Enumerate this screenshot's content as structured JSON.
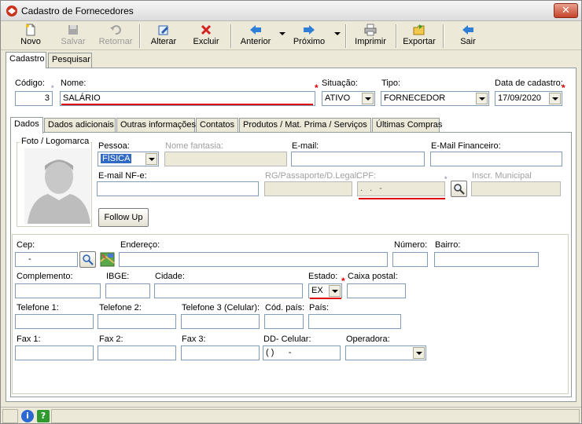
{
  "window": {
    "title": "Cadastro de Fornecedores"
  },
  "toolbar": {
    "novo": "Novo",
    "salvar": "Salvar",
    "retornar": "Retornar",
    "alterar": "Alterar",
    "excluir": "Excluir",
    "anterior": "Anterior",
    "proximo": "Próximo",
    "imprimir": "Imprimir",
    "exportar": "Exportar",
    "sair": "Sair"
  },
  "top_tabs": [
    "Cadastro",
    "Pesquisar"
  ],
  "header": {
    "codigo_label": "Código:",
    "codigo_value": "3",
    "nome_label": "Nome:",
    "nome_value": "SALÁRIO",
    "situacao_label": "Situação:",
    "situacao_value": "ATIVO",
    "tipo_label": "Tipo:",
    "tipo_value": "FORNECEDOR",
    "data_label": "Data de cadastro:",
    "data_value": "17/09/2020"
  },
  "inner_tabs": [
    "Dados",
    "Dados adicionais",
    "Outras informações",
    "Contatos",
    "Produtos / Mat. Prima / Serviços",
    "Últimas Compras"
  ],
  "dados": {
    "foto_label": "Foto / Logomarca",
    "pessoa_label": "Pessoa:",
    "pessoa_value": "FÍSICA",
    "nome_fantasia_label": "Nome fantasia:",
    "email_label": "E-mail:",
    "email_fin_label": "E-Mail Financeiro:",
    "email_nfe_label": "E-mail NF-e:",
    "rg_label": "RG/Passaporte/D.Legal:",
    "cpf_label": "CPF:",
    "cpf_mask": ". . -",
    "inscr_label": "Inscr. Municipal",
    "follow_up": "Follow Up"
  },
  "endereco": {
    "cep_label": "Cep:",
    "cep_mask": "-",
    "endereco_label": "Endereço:",
    "numero_label": "Número:",
    "bairro_label": "Bairro:",
    "complemento_label": "Complemento:",
    "ibge_label": "IBGE:",
    "cidade_label": "Cidade:",
    "estado_label": "Estado:",
    "estado_value": "EX",
    "caixa_postal_label": "Caixa postal:",
    "tel1_label": "Telefone 1:",
    "tel2_label": "Telefone 2:",
    "tel3_label": "Telefone 3 (Celular):",
    "cod_pais_label": "Cód. país:",
    "pais_label": "País:",
    "fax1_label": "Fax 1:",
    "fax2_label": "Fax 2:",
    "fax3_label": "Fax 3:",
    "dd_celular_label": "DD- Celular:",
    "dd_celular_mask": "( )      -",
    "operadora_label": "Operadora:"
  },
  "colors": {
    "required": "#e00000",
    "selection": "#316ac5"
  }
}
